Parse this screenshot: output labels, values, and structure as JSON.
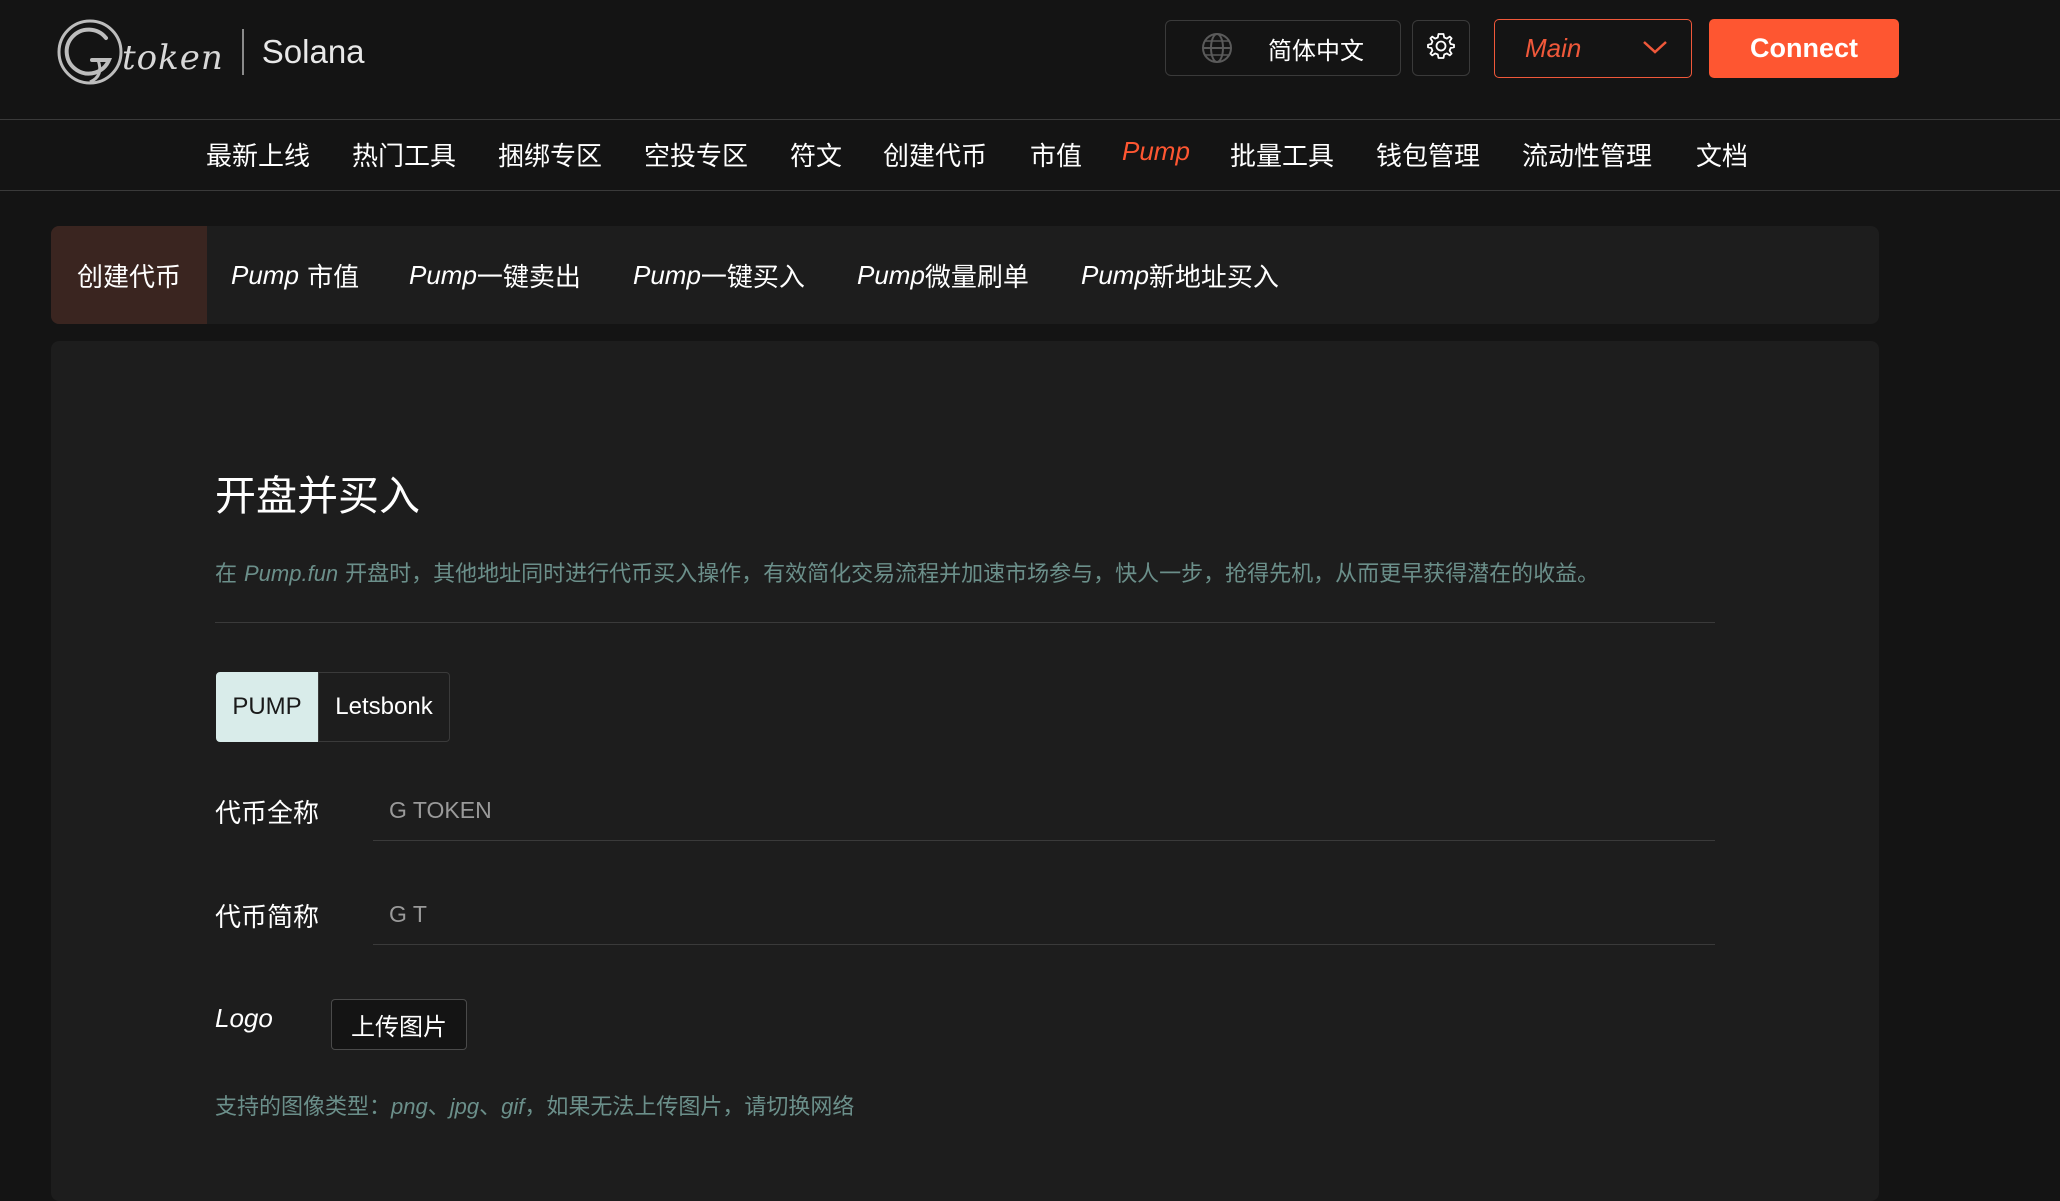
{
  "header": {
    "logo_word": "token",
    "chain": "Solana",
    "language": "简体中文",
    "network": "Main",
    "connect_label": "Connect"
  },
  "main_nav": [
    {
      "label": "最新上线",
      "active": false
    },
    {
      "label": "热门工具",
      "active": false
    },
    {
      "label": "捆绑专区",
      "active": false
    },
    {
      "label": "空投专区",
      "active": false
    },
    {
      "label": "符文",
      "active": false
    },
    {
      "label": "创建代币",
      "active": false
    },
    {
      "label": "市值",
      "active": false
    },
    {
      "label": "Pump",
      "active": true
    },
    {
      "label": "批量工具",
      "active": false
    },
    {
      "label": "钱包管理",
      "active": false
    },
    {
      "label": "流动性管理",
      "active": false
    },
    {
      "label": "文档",
      "active": false
    }
  ],
  "sub_tabs": [
    {
      "label": "创建代币",
      "active": true
    },
    {
      "prefix": "Pump",
      "label": " 市值",
      "active": false
    },
    {
      "prefix": "Pump",
      "label": "一键卖出",
      "active": false
    },
    {
      "prefix": "Pump",
      "label": "一键买入",
      "active": false
    },
    {
      "prefix": "Pump",
      "label": "微量刷单",
      "active": false
    },
    {
      "prefix": "Pump",
      "label": "新地址买入",
      "active": false
    }
  ],
  "form": {
    "title": "开盘并买入",
    "desc_prefix": "在 ",
    "desc_brand": "Pump.fun",
    "desc_rest": " 开盘时，其他地址同时进行代币买入操作，有效简化交易流程并加速市场参与，快人一步，抢得先机，从而更早获得潜在的收益。",
    "protocols": [
      "PUMP",
      "Letsbonk"
    ],
    "selected_protocol": "PUMP",
    "name_label": "代币全称",
    "name_placeholder": "G TOKEN",
    "symbol_label": "代币简称",
    "symbol_placeholder": "G T",
    "logo_label": "Logo",
    "upload_label": "上传图片",
    "hint_prefix": "支持的图像类型：",
    "hint_png": "png",
    "hint_sep1": "、",
    "hint_jpg": "jpg",
    "hint_sep2": "、",
    "hint_gif": "gif",
    "hint_rest": "，如果无法上传图片，请切换网络"
  },
  "colors": {
    "accent": "#fe5631",
    "background": "#141414",
    "panel": "#1d1d1d",
    "muted_teal": "#6b8f8a"
  }
}
